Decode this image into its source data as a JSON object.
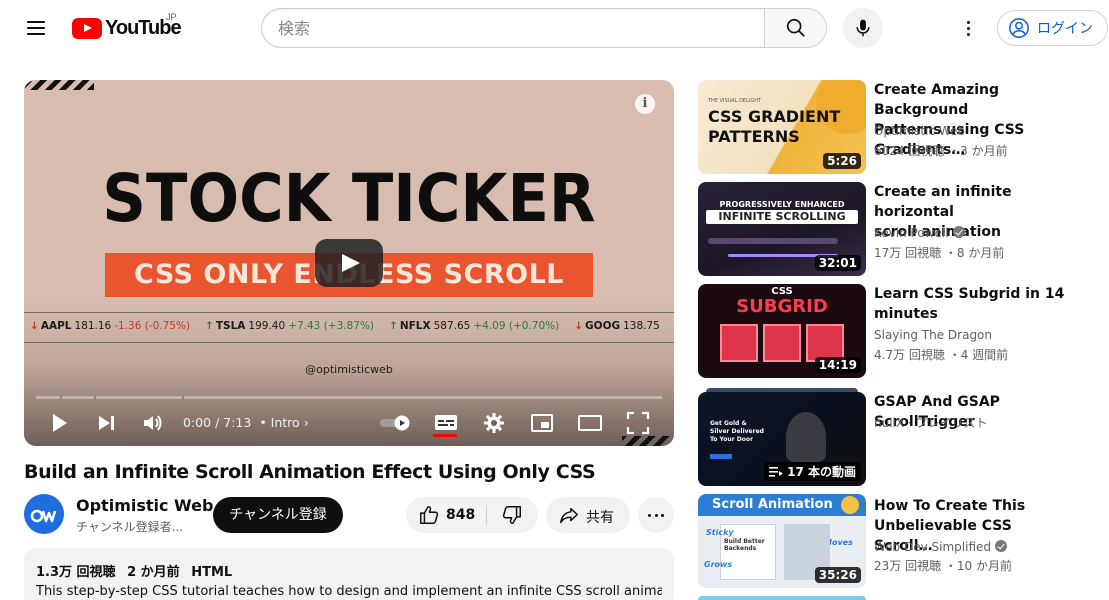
{
  "header": {
    "logo_text": "YouTube",
    "region": "JP",
    "search_placeholder": "検索",
    "login_label": "ログイン"
  },
  "player": {
    "video_title": "STOCK TICKER",
    "video_subtitle": "CSS ONLY ENDLESS SCROLL",
    "handle": "@optimisticweb",
    "time_current": "0:00",
    "time_total": "7:13",
    "time_sep": "/",
    "chapter": "• Intro",
    "chapter_arrow": "›",
    "info_glyph": "i",
    "progress": 0.0,
    "ticker": [
      {
        "arrow": "↓",
        "symbol": "AAPL",
        "price": "181.16",
        "change": "-1.36 (-0.75%)",
        "direction": "down"
      },
      {
        "arrow": "↑",
        "symbol": "TSLA",
        "price": "199.40",
        "change": "+7.43 (+3.87%)",
        "direction": "up"
      },
      {
        "arrow": "↑",
        "symbol": "NFLX",
        "price": "587.65",
        "change": "+4.09 (+0.70%)",
        "direction": "up"
      },
      {
        "arrow": "↓",
        "symbol": "GOOG",
        "price": "138.75",
        "change": "",
        "direction": "down"
      }
    ]
  },
  "video": {
    "title": "Build an Infinite Scroll Animation Effect Using Only CSS",
    "channel_name": "Optimistic Web",
    "channel_subs": "チャンネル登録者...",
    "subscribe_label": "チャンネル登録",
    "like_count": "848",
    "share_label": "共有",
    "views": "1.3万 回視聴",
    "age": "2 か月前",
    "tag": "HTML",
    "description": "This step-by-step CSS tutorial teaches how to design and implement an infinite CSS scroll animation"
  },
  "recommendations": [
    {
      "title_line1": "Create Amazing Background",
      "title_line2": "Patterns using CSS Gradients…",
      "channel": "Optimistic Web",
      "verified": false,
      "meta": "6024 回視聴 ・3 か月前",
      "duration": "5:26",
      "thumb_small": "THE VISUAL DELIGHT",
      "thumb_line1": "CSS GRADIENT",
      "thumb_line2": "PATTERNS"
    },
    {
      "title_line1": "Create an infinite horizontal",
      "title_line2": "scroll animation",
      "channel": "Kevin Powell",
      "verified": true,
      "meta": "17万 回視聴 ・8 か月前",
      "duration": "32:01",
      "thumb_line1": "PROGRESSIVELY ENHANCED",
      "thumb_line2": "INFINITE SCROLLING"
    },
    {
      "title_line1": "Learn CSS Subgrid in 14",
      "title_line2": "minutes",
      "channel": "Slaying The Dragon",
      "verified": false,
      "meta": "4.7万 回視聴 ・4 週間前",
      "duration": "14:19",
      "thumb_line1": "CSS",
      "thumb_line2": "SUBGRID"
    },
    {
      "title_line1": "GSAP And GSAP ScrollTrigger",
      "title_line2": "",
      "channel": "nullX · プレイリスト",
      "verified": false,
      "meta": "",
      "duration": "17 本の動画",
      "thumb_line1": "Get Gold & Silver Delivered To Your Door",
      "thumb_line2": ""
    },
    {
      "title_line1": "How To Create This",
      "title_line2": "Unbelievable CSS Scroll…",
      "channel": "Web Dev Simplified",
      "verified": true,
      "meta": "23万 回視聴 ・10 か月前",
      "duration": "35:26",
      "thumb_line1": "Scroll Animation",
      "thumb_line2": "Build Better Backends",
      "thumb_tag1": "Sticky",
      "thumb_tag2": "Moves",
      "thumb_tag3": "Grows"
    }
  ],
  "colors": {
    "brand_red": "#ff0000",
    "link_blue": "#065fd4",
    "ticker_down": "#c0392b",
    "ticker_up": "#2e7d32"
  }
}
